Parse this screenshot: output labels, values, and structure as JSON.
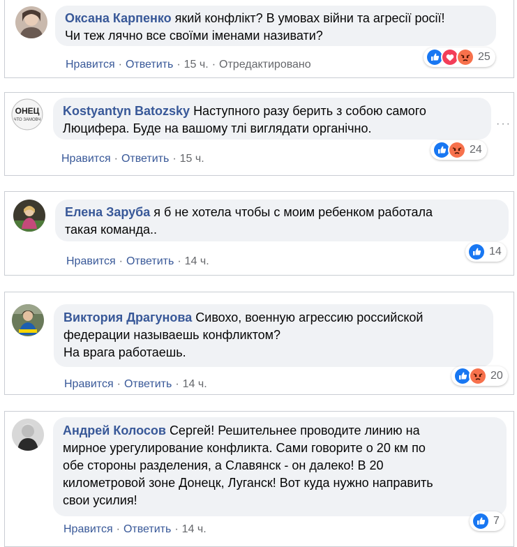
{
  "actions": {
    "like": "Нравится",
    "reply": "Ответить",
    "sep": "·"
  },
  "comments": [
    {
      "author": "Оксана Карпенко",
      "text_lines": [
        "який конфлікт? В умовах війни та агресії росії!",
        "Чи теж лячно все своїми іменами називати?"
      ],
      "time": "15 ч.",
      "edited": "Отредактировано",
      "reactions": [
        "like-icon",
        "love-icon",
        "angry-icon"
      ],
      "reaction_count": "25"
    },
    {
      "author": "Kostyantyn Batozsky",
      "text_lines": [
        "Наступного разу берить з собою самого",
        "Люцифера. Буде на вашому тлі виглядати органічно."
      ],
      "time": "15 ч.",
      "reactions": [
        "like-icon",
        "angry-icon"
      ],
      "reaction_count": "24",
      "more": "···"
    },
    {
      "author": "Елена Заруба",
      "text_lines": [
        "я б не хотела чтобы с моим ребенком работала",
        "такая команда.."
      ],
      "time": "14 ч.",
      "reactions": [
        "like-icon"
      ],
      "reaction_count": "14"
    },
    {
      "author": "Виктория Драгунова",
      "text_lines": [
        "Сивохо, военную агрессию российской",
        "федерации называешь конфликтом?",
        "На врага работаешь."
      ],
      "time": "14 ч.",
      "reactions": [
        "like-icon",
        "angry-icon"
      ],
      "reaction_count": "20"
    },
    {
      "author": "Андрей Колосов",
      "text_lines": [
        "Сергей! Решительнее проводите линию на",
        "мирное урегулирование конфликта. Сами говорите о 20 км по",
        "обе стороны разделения, а Славянск - он далеко! В 20",
        "километровой зоне Донецк, Луганск! Вот куда нужно направить",
        "свои усилия!"
      ],
      "time": "14 ч.",
      "reactions": [
        "like-icon"
      ],
      "reaction_count": "7"
    }
  ],
  "colors": {
    "author": "#385898",
    "bubble": "#f0f2f5",
    "like": "#1877f2",
    "love": "#f33e58",
    "angry": "#f7714c"
  }
}
